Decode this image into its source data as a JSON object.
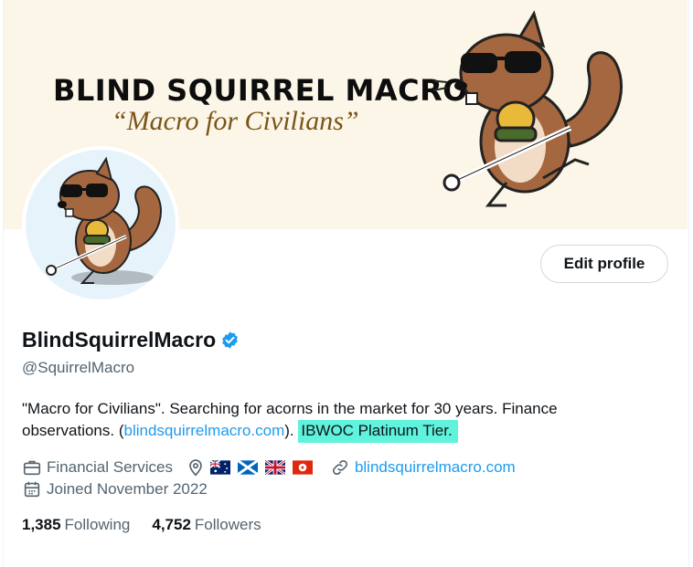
{
  "banner": {
    "title": "BLIND SQUIRREL MACRO",
    "subtitle": "“Macro for Civilians”"
  },
  "profile": {
    "edit_label": "Edit profile",
    "display_name": "BlindSquirrelMacro",
    "handle": "@SquirrelMacro",
    "bio_text_1": "\"Macro for Civilians\". Searching for acorns in the market for 30 years. Finance observations. (",
    "bio_link": "blindsquirrelmacro.com",
    "bio_text_2": "). ",
    "bio_highlight": "IBWOC Platinum Tier.",
    "category": "Financial Services",
    "website": "blindsquirrelmacro.com",
    "joined": "Joined November 2022",
    "following_count": "1,385",
    "following_label": "Following",
    "followers_count": "4,752",
    "followers_label": "Followers"
  },
  "colors": {
    "accent": "#1d9bf0",
    "highlight": "#5ff2dc",
    "banner_bg": "#fbf6e7",
    "squirrel_brown": "#a5673f"
  },
  "icons": {
    "briefcase": "briefcase-icon",
    "location": "location-pin-icon",
    "link": "link-icon",
    "calendar": "calendar-icon",
    "verified": "verified-badge-icon"
  },
  "location_flags": [
    "flag-australia",
    "flag-scotland",
    "flag-uk",
    "flag-hong-kong"
  ]
}
